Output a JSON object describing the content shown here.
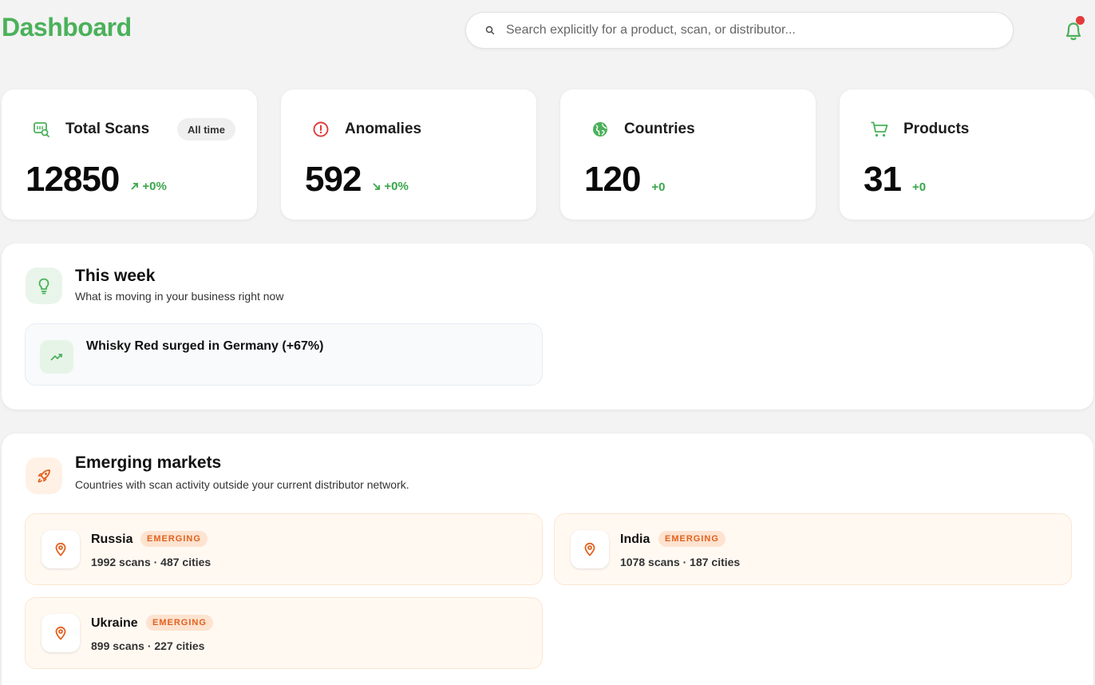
{
  "header": {
    "title": "Dashboard",
    "search_placeholder": "Search explicitly for a product, scan, or distributor..."
  },
  "stats": [
    {
      "label": "Total Scans",
      "pill": "All time",
      "value": "12850",
      "delta": "+0%",
      "icon": "scan-icon",
      "trend": "up"
    },
    {
      "label": "Anomalies",
      "value": "592",
      "delta": "+0%",
      "icon": "alert-circle-icon",
      "trend": "down"
    },
    {
      "label": "Countries",
      "value": "120",
      "delta": "+0",
      "icon": "globe-icon"
    },
    {
      "label": "Products",
      "value": "31",
      "delta": "+0",
      "icon": "cart-icon"
    }
  ],
  "week": {
    "title": "This week",
    "subtitle": "What is moving in your business right now",
    "insights": [
      {
        "text": "Whisky Red surged in Germany (+67%)"
      }
    ]
  },
  "emerging": {
    "title": "Emerging markets",
    "subtitle": "Countries with scan activity outside your current distributor network.",
    "markets": [
      {
        "name": "Russia",
        "badge": "EMERGING",
        "meta": "1992 scans · 487 cities"
      },
      {
        "name": "India",
        "badge": "EMERGING",
        "meta": "1078 scans · 187 cities"
      },
      {
        "name": "Ukraine",
        "badge": "EMERGING",
        "meta": "899 scans · 227 cities"
      }
    ]
  },
  "colors": {
    "brand_green": "#4bb15a",
    "alert_red": "#e03a3a",
    "emerging_orange": "#e2611e",
    "notification_dot": "#e23b3b"
  }
}
